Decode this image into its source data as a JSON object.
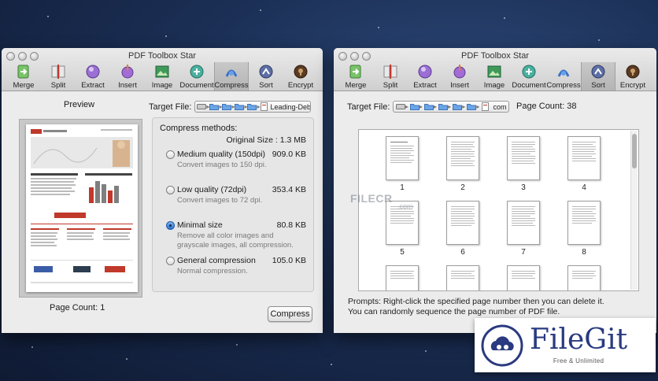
{
  "left_window": {
    "title": "PDF Toolbox Star",
    "toolbar": [
      {
        "label": "Merge",
        "icon": "merge-icon"
      },
      {
        "label": "Split",
        "icon": "split-icon"
      },
      {
        "label": "Extract",
        "icon": "extract-icon"
      },
      {
        "label": "Insert",
        "icon": "insert-icon"
      },
      {
        "label": "Image",
        "icon": "image-icon"
      },
      {
        "label": "Document",
        "icon": "document-icon"
      },
      {
        "label": "Compress",
        "icon": "compress-icon",
        "active": true
      },
      {
        "label": "Sort",
        "icon": "sort-icon"
      },
      {
        "label": "Encrypt",
        "icon": "encrypt-icon"
      }
    ],
    "preview_heading": "Preview",
    "target_file_label": "Target File:",
    "target_file_name": "Leading-Debt",
    "compress_title": "Compress methods:",
    "original_size": "Original Size : 1.3 MB",
    "options": [
      {
        "label": "Medium quality (150dpi)",
        "size": "909.0 KB",
        "description": "Convert images to 150 dpi.",
        "checked": false
      },
      {
        "label": "Low quality (72dpi)",
        "size": "353.4 KB",
        "description": "Convert images to 72 dpi.",
        "checked": false
      },
      {
        "label": "Minimal size",
        "size": "80.8 KB",
        "description": "Remove all color images and grayscale images, all compression.",
        "checked": true
      },
      {
        "label": "General compression",
        "size": "105.0 KB",
        "description": "Normal compression.",
        "checked": false
      }
    ],
    "page_count": "Page Count: 1",
    "compress_button": "Compress"
  },
  "right_window": {
    "title": "PDF Toolbox Star",
    "toolbar": [
      {
        "label": "Merge",
        "icon": "merge-icon"
      },
      {
        "label": "Split",
        "icon": "split-icon"
      },
      {
        "label": "Extract",
        "icon": "extract-icon"
      },
      {
        "label": "Insert",
        "icon": "insert-icon"
      },
      {
        "label": "Image",
        "icon": "image-icon"
      },
      {
        "label": "Document",
        "icon": "document-icon"
      },
      {
        "label": "Compress",
        "icon": "compress-icon"
      },
      {
        "label": "Sort",
        "icon": "sort-icon",
        "active": true
      },
      {
        "label": "Encrypt",
        "icon": "encrypt-icon"
      }
    ],
    "target_file_label": "Target File:",
    "target_file_name": "com",
    "page_count": "Page Count: 38",
    "pages": [
      "1",
      "2",
      "3",
      "4",
      "5",
      "6",
      "7",
      "8"
    ],
    "prompt_line1": "Prompts: Right-click the specified page number then you can delete it.",
    "prompt_line2": "You can randomly sequence the page number of PDF file."
  },
  "watermarks": {
    "filecr": "FILECR",
    "filecr_sub": ".com",
    "filegit_name": "FileGit",
    "filegit_tagline": "Free & Unlimited"
  },
  "colors": {
    "desktop": "#1b2f55",
    "window_bg": "#ececec",
    "accent": "#2a6fd0",
    "filegit_blue": "#2a3a80"
  }
}
